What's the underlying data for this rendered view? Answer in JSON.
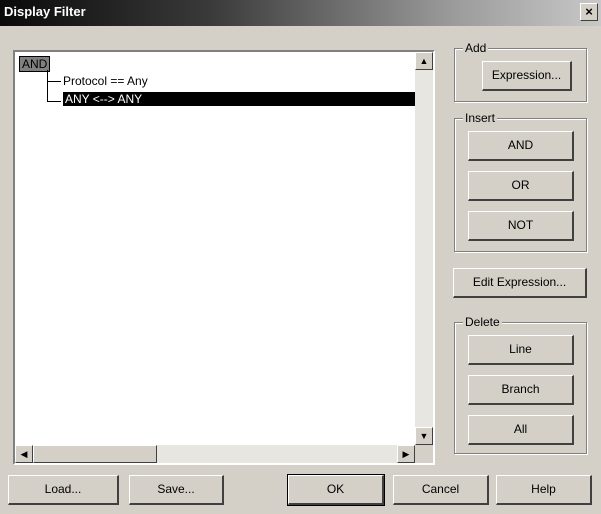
{
  "window": {
    "title": "Display Filter",
    "close_glyph": "×"
  },
  "tree": {
    "root": "AND",
    "children": [
      "Protocol == Any",
      "ANY <--> ANY"
    ],
    "selected_index": 1
  },
  "scrollbars": {
    "up": "▲",
    "down": "▼",
    "left": "◀",
    "right": "▶"
  },
  "groups": {
    "add": {
      "label": "Add",
      "expression_button": "Expression..."
    },
    "insert": {
      "label": "Insert",
      "and_button": "AND",
      "or_button": "OR",
      "not_button": "NOT"
    },
    "edit_expression_button": "Edit Expression...",
    "delete": {
      "label": "Delete",
      "line_button": "Line",
      "branch_button": "Branch",
      "all_button": "All"
    }
  },
  "footer": {
    "load": "Load...",
    "save": "Save...",
    "ok": "OK",
    "cancel": "Cancel",
    "help": "Help"
  }
}
